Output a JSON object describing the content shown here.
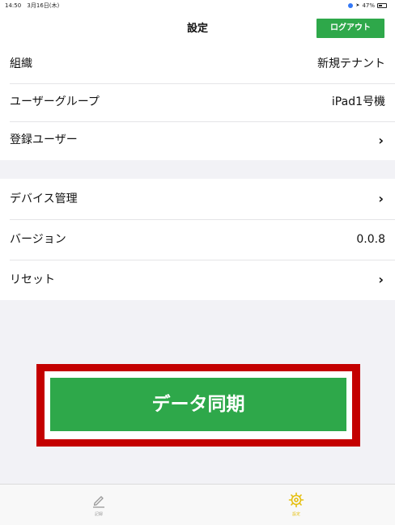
{
  "status_bar": {
    "time": "14:50",
    "date": "3月16日(木)",
    "battery": "47%",
    "battery_level": 0.47
  },
  "header": {
    "title": "設定",
    "logout_label": "ログアウト"
  },
  "settings_group_1": [
    {
      "label": "組織",
      "value": "新規テナント"
    },
    {
      "label": "ユーザーグループ",
      "value": "iPad1号機"
    },
    {
      "label": "登録ユーザー",
      "chevron": "›"
    }
  ],
  "settings_group_2": [
    {
      "label": "デバイス管理",
      "chevron": "›"
    },
    {
      "label": "バージョン",
      "value": "0.0.8"
    },
    {
      "label": "リセット",
      "chevron": "›"
    }
  ],
  "sync_button_label": "データ同期",
  "tab_bar": {
    "input_label": "記録",
    "settings_label": "設定"
  },
  "colors": {
    "accent_green": "#2ea84a",
    "highlight_red": "#c40000",
    "active_tab_yellow": "#e5bf10"
  },
  "icons": {
    "input_tab": "pencil-icon",
    "settings_tab": "gear-icon",
    "row_disclosure": "chevron-right-icon"
  }
}
